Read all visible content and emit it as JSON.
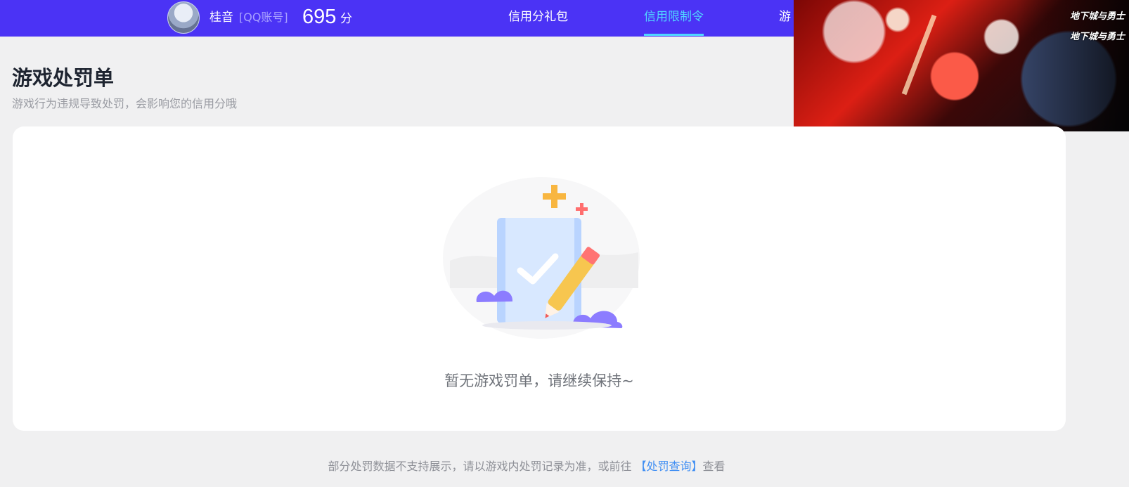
{
  "header": {
    "user_name": "桂音",
    "account_type": "[QQ账号]",
    "score": "695",
    "score_unit": "分",
    "nav": {
      "gift": "信用分礼包",
      "limit": "信用限制令",
      "more": "游"
    },
    "accent_color": "#4b33f5",
    "active_tab_color": "#50d6ff"
  },
  "ad": {
    "logo_line1": "地下城与勇士",
    "logo_line2": "地下城与勇士"
  },
  "main": {
    "title": "游戏处罚单",
    "subtitle": "游戏行为违规导致处罚，会影响您的信用分哦",
    "empty_message": "暂无游戏罚单，请继续保持~",
    "footer": {
      "prefix": "部分处罚数据不支持展示，请以游戏内处罚记录为准，或前往 ",
      "link": "【处罚查询】",
      "suffix": "查看"
    }
  }
}
